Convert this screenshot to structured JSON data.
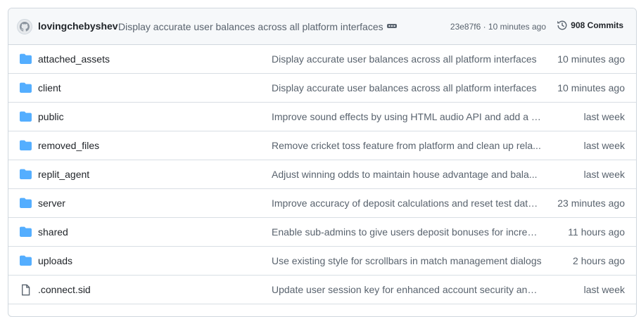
{
  "latest_commit": {
    "author": "lovingchebyshev",
    "message": "Display accurate user balances across all platform interfaces",
    "sha_time": "23e87f6 · 10 minutes ago",
    "commits_label": "908 Commits"
  },
  "files": [
    {
      "name": "attached_assets",
      "type": "folder",
      "message": "Display accurate user balances across all platform interfaces",
      "time": "10 minutes ago"
    },
    {
      "name": "client",
      "type": "folder",
      "message": "Display accurate user balances across all platform interfaces",
      "time": "10 minutes ago"
    },
    {
      "name": "public",
      "type": "folder",
      "message": "Improve sound effects by using HTML audio API and add a c...",
      "time": "last week"
    },
    {
      "name": "removed_files",
      "type": "folder",
      "message": "Remove cricket toss feature from platform and clean up rela...",
      "time": "last week"
    },
    {
      "name": "replit_agent",
      "type": "folder",
      "message": "Adjust winning odds to maintain house advantage and bala...",
      "time": "last week"
    },
    {
      "name": "server",
      "type": "folder",
      "message": "Improve accuracy of deposit calculations and reset test data ...",
      "time": "23 minutes ago"
    },
    {
      "name": "shared",
      "type": "folder",
      "message": "Enable sub-admins to give users deposit bonuses for increas...",
      "time": "11 hours ago"
    },
    {
      "name": "uploads",
      "type": "folder",
      "message": "Use existing style for scrollbars in match management dialogs",
      "time": "2 hours ago"
    },
    {
      "name": ".connect.sid",
      "type": "file",
      "message": "Update user session key for enhanced account security and ...",
      "time": "last week"
    }
  ],
  "colors": {
    "folder": "#54aeff",
    "file": "#59636e",
    "header_bg": "#f6f8fa",
    "border": "#d0d7de"
  }
}
